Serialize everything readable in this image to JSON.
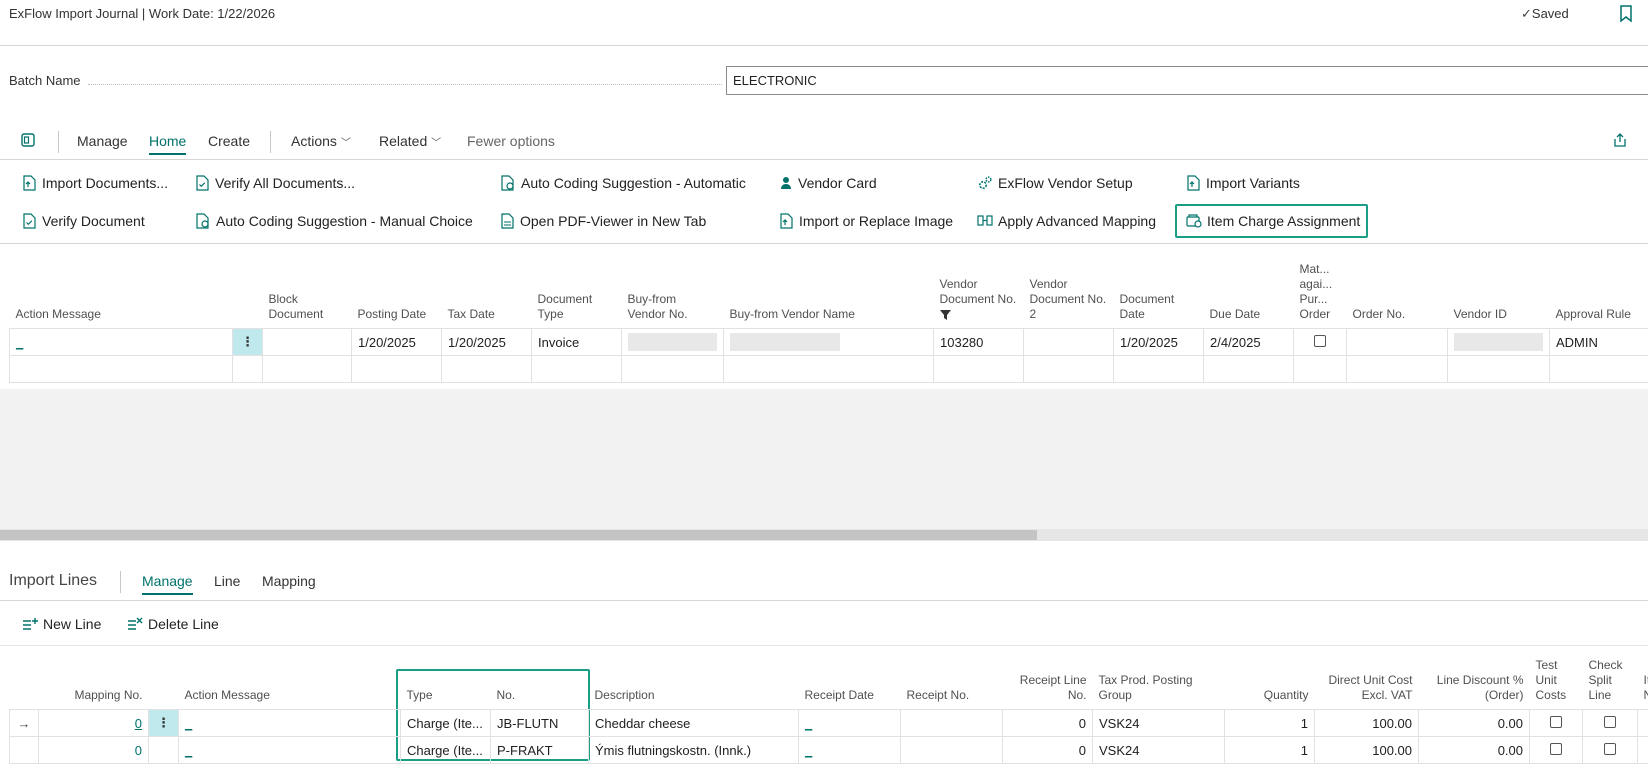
{
  "title": "ExFlow Import Journal | Work Date: 1/22/2026",
  "saved_label": "Saved",
  "batch": {
    "label": "Batch Name",
    "value": "ELECTRONIC"
  },
  "ribbon": {
    "tabs": [
      "Manage",
      "Home",
      "Create",
      "Actions",
      "Related",
      "Fewer options"
    ],
    "actions_row1": [
      "Import Documents...",
      "Verify All Documents...",
      "Auto Coding Suggestion - Automatic",
      "Vendor Card",
      "ExFlow Vendor Setup",
      "Import Variants"
    ],
    "actions_row2": [
      "Verify Document",
      "Auto Coding Suggestion - Manual Choice",
      "Open PDF-Viewer in New Tab",
      "Import or Replace Image",
      "Apply Advanced Mapping",
      "Item Charge Assignment"
    ]
  },
  "header_grid": {
    "columns": [
      "Action Message",
      "Block Document",
      "Posting Date",
      "Tax Date",
      "Document Type",
      "Buy-from Vendor No.",
      "Buy-from Vendor Name",
      "Vendor Document No.",
      "Vendor Document No. 2",
      "Document Date",
      "Due Date",
      "Mat... agai... Pur... Order",
      "Order No.",
      "Vendor ID",
      "Approval Rule"
    ],
    "row": {
      "action_message": "_",
      "posting_date": "1/20/2025",
      "tax_date": "1/20/2025",
      "document_type": "Invoice",
      "vendor_document_no": "103280",
      "document_date": "1/20/2025",
      "due_date": "2/4/2025",
      "approval_rule": "ADMIN"
    }
  },
  "lines": {
    "title": "Import Lines",
    "tabs": [
      "Manage",
      "Line",
      "Mapping"
    ],
    "actions": [
      "New Line",
      "Delete Line"
    ],
    "columns": [
      "Mapping No.",
      "Action Message",
      "Type",
      "No.",
      "Description",
      "Receipt Date",
      "Receipt No.",
      "Receipt Line No.",
      "Tax Prod. Posting Group",
      "Quantity",
      "Direct Unit Cost Excl. VAT",
      "Line Discount % (Order)",
      "Test Unit Costs",
      "Check Split Line",
      "Ite Re No"
    ],
    "rows": [
      {
        "mapping_no": "0",
        "action_message": "_",
        "type": "Charge (Ite...",
        "no": "JB-FLUTN",
        "description": "Cheddar cheese",
        "receipt_date": "_",
        "receipt_line_no": "0",
        "tax_group": "VSK24",
        "quantity": "1",
        "unit_cost": "100.00",
        "discount": "0.00"
      },
      {
        "mapping_no": "0",
        "action_message": "_",
        "type": "Charge (Ite...",
        "no": "P-FRAKT",
        "description": "Ýmis flutningskostn. (Innk.)",
        "receipt_date": "_",
        "receipt_line_no": "0",
        "tax_group": "VSK24",
        "quantity": "1",
        "unit_cost": "100.00",
        "discount": "0.00"
      }
    ]
  }
}
